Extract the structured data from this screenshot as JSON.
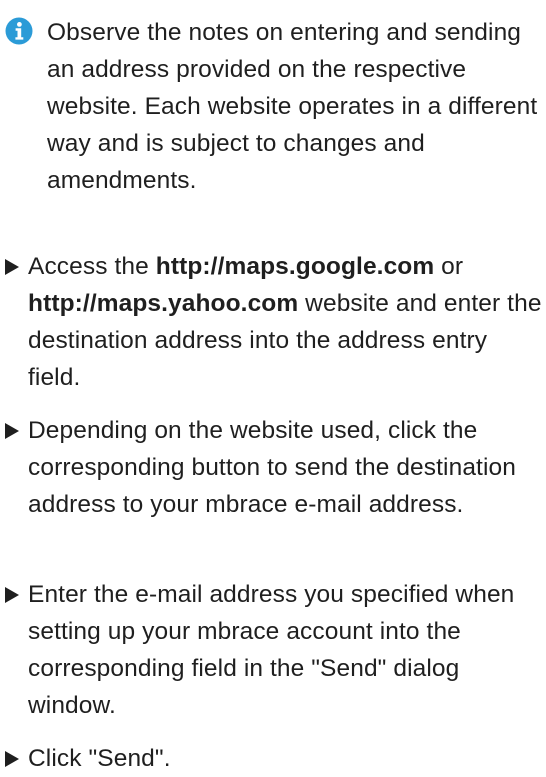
{
  "info_note": {
    "icon": "info-icon",
    "text": "Observe the notes on entering and sending an address provided on the respective website. Each website operates in a different way and is subject to changes and amendments."
  },
  "steps": [
    {
      "bullet_icon": "triangle-right-icon",
      "text_before": "Access the ",
      "link_1": "http://maps.google.com",
      "text_between": " or ",
      "link_2": "http://maps.yahoo.com",
      "text_after": " website and enter the destination address into the address entry field."
    },
    {
      "bullet_icon": "triangle-right-icon",
      "text": "Depending on the website used, click the corresponding button to send the destination address to your mbrace e-mail address."
    },
    {
      "bullet_icon": "triangle-right-icon",
      "text": "Enter the e-mail address you specified when setting up your mbrace account into the corresponding field in the \"Send\" dialog window."
    },
    {
      "bullet_icon": "triangle-right-icon",
      "text": "Click \"Send\"."
    }
  ],
  "colors": {
    "accent": "#2b9bd7",
    "text": "#1f1f1f",
    "background": "#ffffff"
  }
}
